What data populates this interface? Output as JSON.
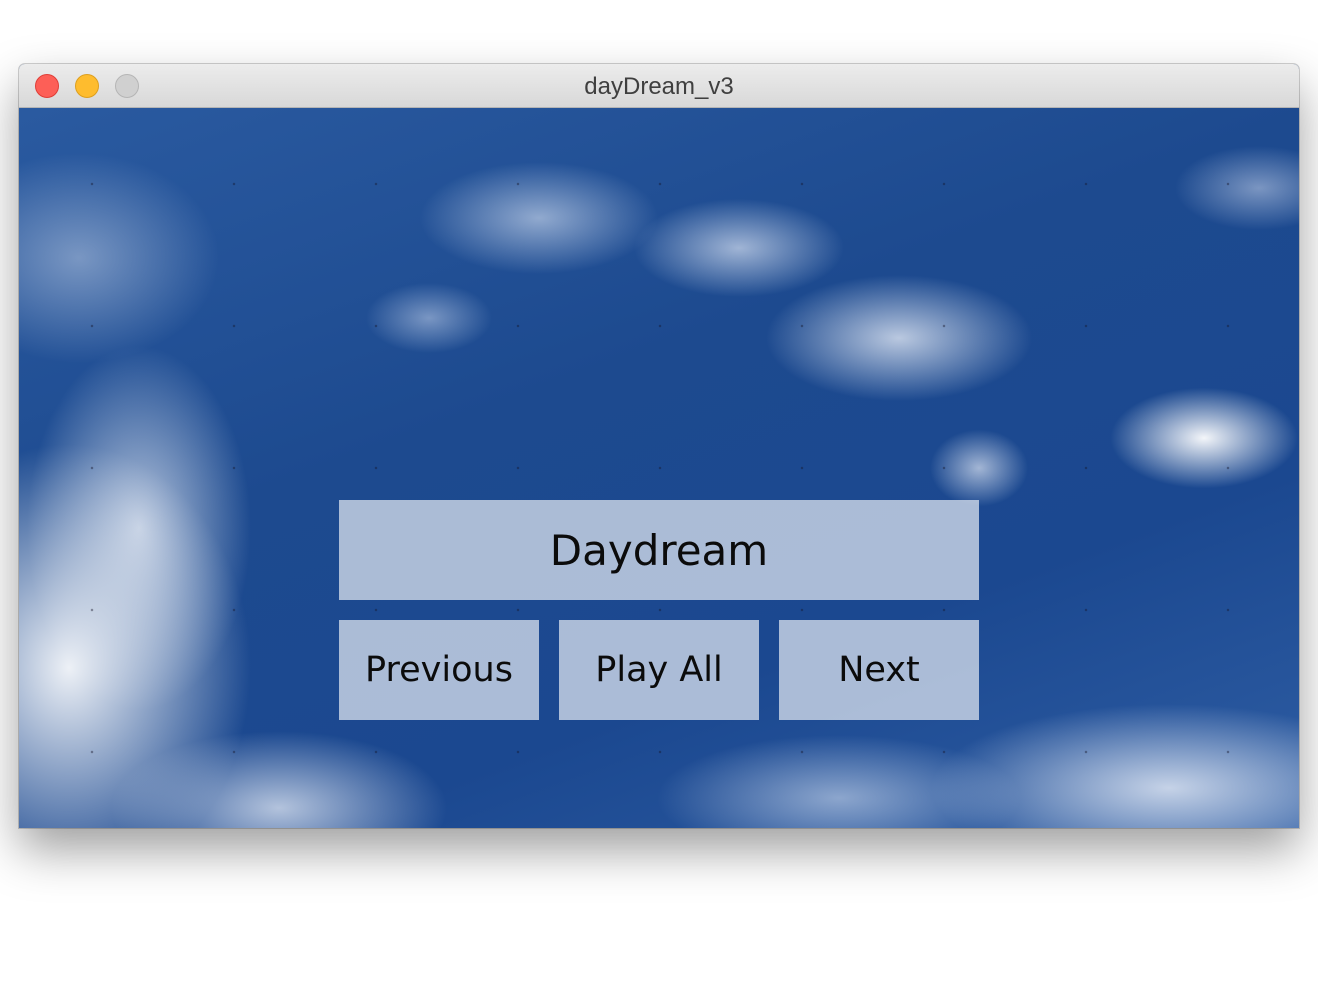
{
  "window": {
    "title": "dayDream_v3",
    "controls": [
      "close",
      "minimize",
      "zoom"
    ]
  },
  "player": {
    "title_label": "Daydream",
    "previous_label": "Previous",
    "play_all_label": "Play All",
    "next_label": "Next"
  },
  "colors": {
    "sky": "#1f4b8e",
    "button_bg": "#d4dcea",
    "close": "#fd5f57",
    "minimize": "#febc2e",
    "zoom_disabled": "#d0d0d0"
  }
}
